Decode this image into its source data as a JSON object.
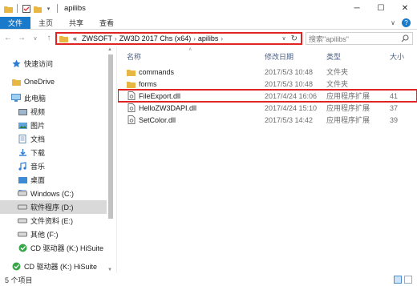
{
  "window": {
    "title": "apilibs",
    "controls": {
      "minimize": "─",
      "maximize": "☐",
      "close": "✕"
    }
  },
  "ribbon": {
    "tabs": [
      "文件",
      "主页",
      "共享",
      "查看"
    ],
    "expand_symbol": "∨",
    "help_symbol": "?"
  },
  "address_bar": {
    "breadcrumb": [
      "«",
      "ZWSOFT",
      "ZW3D 2017 Chs (x64)",
      "apilibs"
    ],
    "separator": "›"
  },
  "search": {
    "placeholder": "搜索\"apilibs\""
  },
  "sidebar": {
    "items": [
      {
        "label": "快速访问",
        "icon": "star-icon"
      },
      {
        "label": "OneDrive",
        "icon": "folder-icon"
      },
      {
        "label": "此电脑",
        "icon": "computer-icon"
      },
      {
        "label": "视频",
        "icon": "video-folder-icon"
      },
      {
        "label": "图片",
        "icon": "picture-folder-icon"
      },
      {
        "label": "文档",
        "icon": "document-folder-icon"
      },
      {
        "label": "下载",
        "icon": "download-folder-icon"
      },
      {
        "label": "音乐",
        "icon": "music-folder-icon"
      },
      {
        "label": "桌面",
        "icon": "desktop-folder-icon"
      },
      {
        "label": "Windows (C:)",
        "icon": "drive-icon"
      },
      {
        "label": "软件程序 (D:)",
        "icon": "drive-icon",
        "selected": true
      },
      {
        "label": "文件资料 (E:)",
        "icon": "drive-icon"
      },
      {
        "label": "其他 (F:)",
        "icon": "drive-icon"
      },
      {
        "label": "CD 驱动器 (K:) HiSuite",
        "icon": "cd-drive-icon"
      },
      {
        "label": "CD 驱动器 (K:) HiSuite",
        "icon": "cd-drive-icon"
      }
    ]
  },
  "file_list": {
    "columns": [
      "名称",
      "修改日期",
      "类型",
      "大小"
    ],
    "rows": [
      {
        "name": "commands",
        "date": "2017/5/3 10:48",
        "type": "文件夹",
        "size": "",
        "icon": "folder-icon"
      },
      {
        "name": "forms",
        "date": "2017/5/3 10:48",
        "type": "文件夹",
        "size": "",
        "icon": "folder-icon"
      },
      {
        "name": "FileExport.dll",
        "date": "2017/4/24 16:06",
        "type": "应用程序扩展",
        "size": "41",
        "icon": "dll-file-icon",
        "highlighted": true
      },
      {
        "name": "HelloZW3DAPI.dll",
        "date": "2017/4/24 15:10",
        "type": "应用程序扩展",
        "size": "37",
        "icon": "dll-file-icon"
      },
      {
        "name": "SetColor.dll",
        "date": "2017/5/3 14:42",
        "type": "应用程序扩展",
        "size": "39",
        "icon": "dll-file-icon"
      }
    ]
  },
  "status": {
    "item_count": "5 个项目"
  },
  "colors": {
    "accent": "#1979ca",
    "highlight": "#e02424",
    "folder": "#e8b642"
  }
}
